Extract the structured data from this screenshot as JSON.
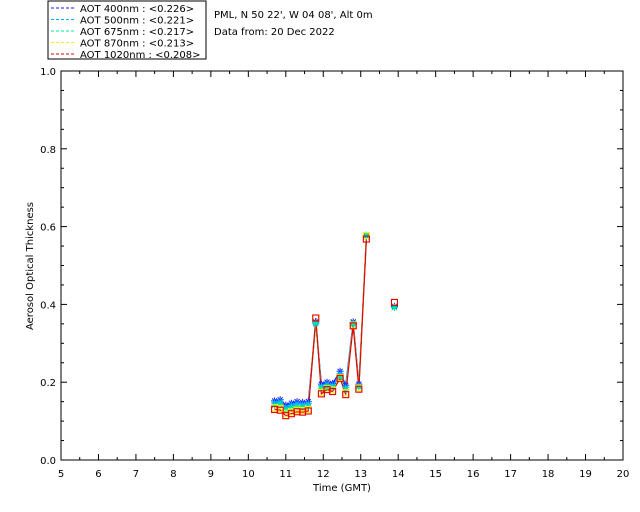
{
  "header": {
    "location": "PML, N 50 22', W 04 08', Alt 0m",
    "date_line": "Data from: 20 Dec 2022"
  },
  "chart_data": {
    "type": "line",
    "xlabel": "Time (GMT)",
    "ylabel": "Aerosol Optical Thickness",
    "xlim": [
      5,
      20
    ],
    "ylim": [
      0.0,
      1.0
    ],
    "x_ticks": [
      "5",
      "6",
      "7",
      "8",
      "9",
      "10",
      "11",
      "12",
      "13",
      "14",
      "15",
      "16",
      "17",
      "18",
      "19",
      "20"
    ],
    "y_ticks": [
      "0.0",
      "0.2",
      "0.4",
      "0.6",
      "0.8",
      "1.0"
    ],
    "grid": false,
    "legend_position": "top-left",
    "x": [
      10.7,
      10.85,
      11.0,
      11.15,
      11.3,
      11.45,
      11.6,
      11.8,
      11.95,
      12.1,
      12.25,
      12.45,
      12.6,
      12.8,
      12.95,
      13.15,
      13.9
    ],
    "series": [
      {
        "name": "AOT  400nm : <0.226>",
        "color": "#1a1aff",
        "marker": "star",
        "values": [
          0.152,
          0.155,
          0.141,
          0.146,
          0.15,
          0.148,
          0.15,
          0.355,
          0.195,
          0.2,
          0.197,
          0.228,
          0.192,
          0.355,
          0.195,
          0.575,
          0.395
        ]
      },
      {
        "name": "AOT  500nm : <0.221>",
        "color": "#00aaff",
        "marker": "star",
        "values": [
          0.147,
          0.15,
          0.136,
          0.141,
          0.145,
          0.143,
          0.145,
          0.352,
          0.19,
          0.195,
          0.192,
          0.222,
          0.187,
          0.352,
          0.191,
          0.574,
          0.393
        ]
      },
      {
        "name": "AOT  675nm : <0.217>",
        "color": "#00e6a0",
        "marker": "star",
        "values": [
          0.14,
          0.143,
          0.129,
          0.134,
          0.138,
          0.136,
          0.138,
          0.35,
          0.184,
          0.188,
          0.186,
          0.215,
          0.181,
          0.35,
          0.188,
          0.578,
          0.392
        ]
      },
      {
        "name": "AOT  870nm : <0.213>",
        "color": "#ffee00",
        "marker": "square",
        "values": [
          0.134,
          0.132,
          0.12,
          0.124,
          0.128,
          0.127,
          0.13,
          0.365,
          0.174,
          0.183,
          0.18,
          0.212,
          0.173,
          0.347,
          0.185,
          0.577,
          0.405
        ]
      },
      {
        "name": "AOT 1020nm : <0.208>",
        "color": "#e60000",
        "marker": "square",
        "values": [
          0.13,
          0.128,
          0.114,
          0.119,
          0.124,
          0.123,
          0.126,
          0.365,
          0.17,
          0.181,
          0.176,
          0.21,
          0.168,
          0.345,
          0.182,
          0.568,
          0.405
        ]
      }
    ]
  }
}
